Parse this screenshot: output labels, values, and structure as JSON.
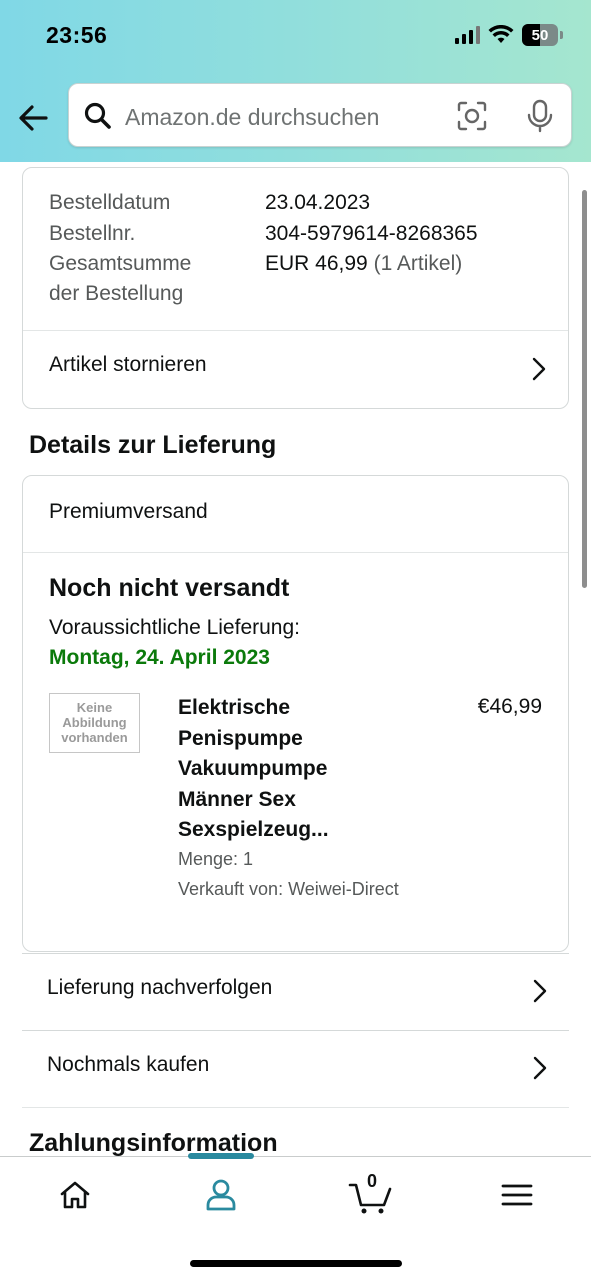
{
  "status_bar": {
    "time": "23:56",
    "battery": "50"
  },
  "search": {
    "placeholder": "Amazon.de durchsuchen"
  },
  "summary": {
    "order_date_label": "Bestelldatum",
    "order_date": "23.04.2023",
    "order_number_label": "Bestellnr.",
    "order_number": "304-5979614-8268365",
    "total_label_line1": "Gesamtsumme",
    "total_label_line2": "der Bestellung",
    "total_value": "EUR 46,99",
    "total_items": "(1 Artikel)",
    "cancel_label": "Artikel stornieren"
  },
  "delivery": {
    "section_title": "Details zur Lieferung",
    "shipping_method": "Premiumversand",
    "status": "Noch nicht versandt",
    "eta_label": "Voraussichtliche Lieferung:",
    "eta_date": "Montag, 24. April 2023",
    "item": {
      "image_placeholder": "Keine Abbildung vorhanden",
      "title": "Elektrische Penispumpe Vakuumpumpe Männer Sex Sexspielzeug...",
      "price": "€46,99",
      "quantity": "Menge: 1",
      "seller": "Verkauft von: Weiwei-Direct"
    }
  },
  "actions": {
    "track": "Lieferung nachverfolgen",
    "buy_again": "Nochmals kaufen"
  },
  "payment": {
    "section_title": "Zahlungsinformation"
  },
  "bottom_nav": {
    "cart_count": "0"
  },
  "colors": {
    "accent": "#2a8a9f",
    "delivery_green": "#0b7a0b"
  }
}
